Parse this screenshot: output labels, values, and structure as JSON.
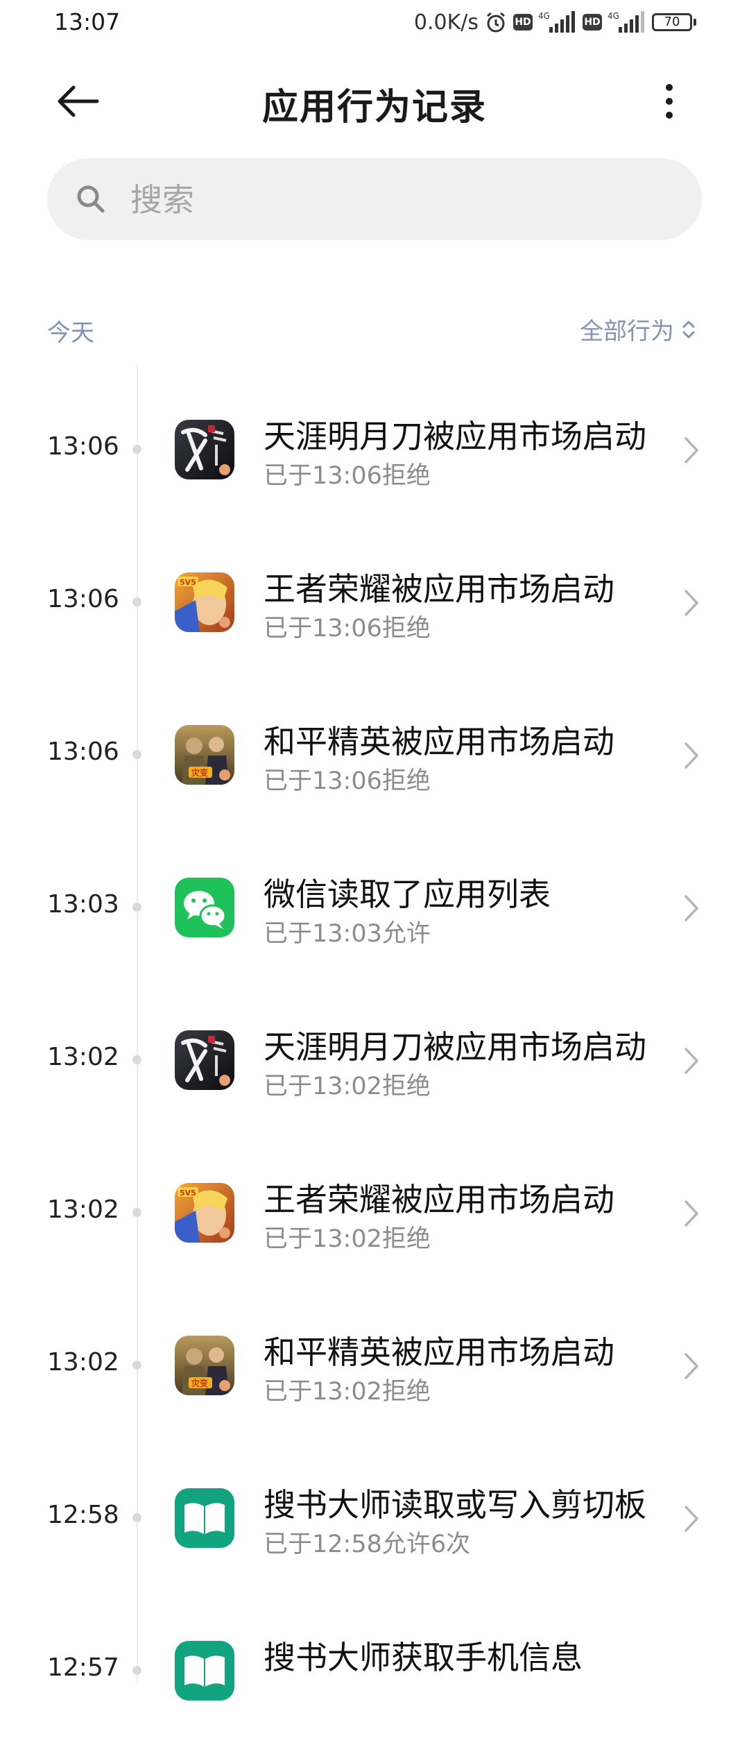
{
  "status_bar": {
    "time": "13:07",
    "net_speed": "0.0K/s",
    "sim1": "4G",
    "sim2": "4G",
    "hd": "HD",
    "battery": "70"
  },
  "header": {
    "title": "应用行为记录"
  },
  "search": {
    "placeholder": "搜索"
  },
  "section": {
    "label": "今天",
    "filter_label": "全部行为"
  },
  "records": [
    {
      "time": "13:06",
      "title": "天涯明月刀被应用市场启动",
      "status": "已于13:06拒绝",
      "icon": "tianya-mingyuedao-icon"
    },
    {
      "time": "13:06",
      "title": "王者荣耀被应用市场启动",
      "status": "已于13:06拒绝",
      "icon": "honor-of-kings-icon"
    },
    {
      "time": "13:06",
      "title": "和平精英被应用市场启动",
      "status": "已于13:06拒绝",
      "icon": "peacekeeper-elite-icon"
    },
    {
      "time": "13:03",
      "title": "微信读取了应用列表",
      "status": "已于13:03允许",
      "icon": "wechat-icon"
    },
    {
      "time": "13:02",
      "title": "天涯明月刀被应用市场启动",
      "status": "已于13:02拒绝",
      "icon": "tianya-mingyuedao-icon"
    },
    {
      "time": "13:02",
      "title": "王者荣耀被应用市场启动",
      "status": "已于13:02拒绝",
      "icon": "honor-of-kings-icon"
    },
    {
      "time": "13:02",
      "title": "和平精英被应用市场启动",
      "status": "已于13:02拒绝",
      "icon": "peacekeeper-elite-icon"
    },
    {
      "time": "12:58",
      "title": "搜书大师读取或写入剪切板",
      "status": "已于12:58允许6次",
      "icon": "soushu-dashi-icon"
    },
    {
      "time": "12:57",
      "title": "搜书大师获取手机信息",
      "status": "",
      "icon": "soushu-dashi-icon"
    }
  ],
  "colors": {
    "accent_muted": "#8393b3",
    "wechat_green": "#1fc25a",
    "soushu_teal": "#12a37f"
  }
}
